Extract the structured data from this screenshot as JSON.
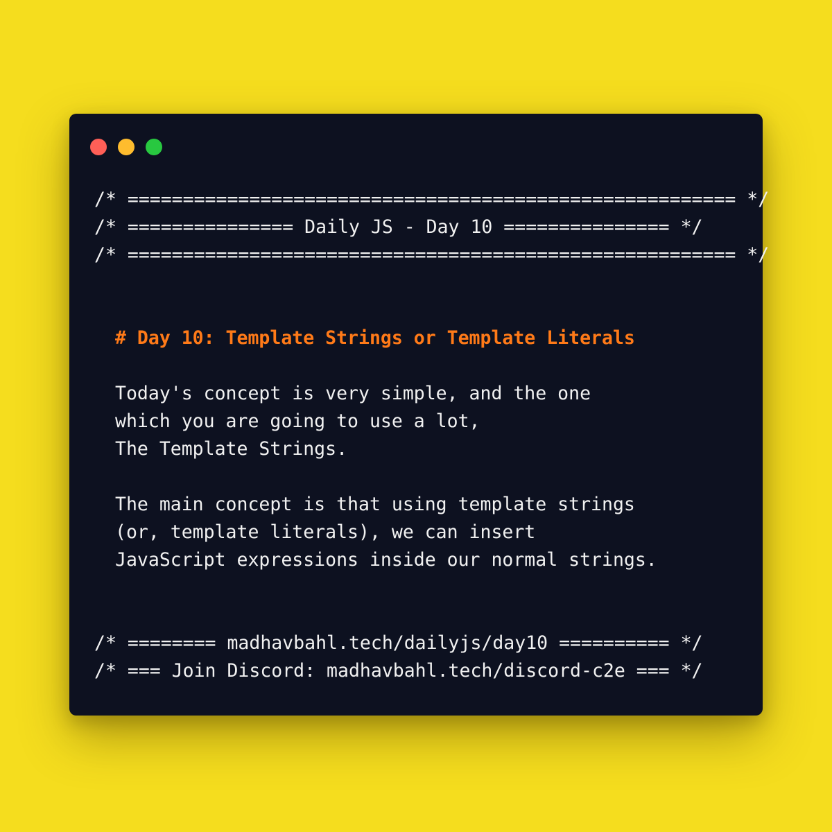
{
  "window": {
    "controls": [
      {
        "name": "close",
        "color": "#ff5f57"
      },
      {
        "name": "minimize",
        "color": "#febc2e"
      },
      {
        "name": "maximize",
        "color": "#28c840"
      }
    ]
  },
  "colors": {
    "page_background": "#f5dd1e",
    "window_background": "#0d1120",
    "text": "#f1f1f1",
    "heading": "#ff7a18"
  },
  "header": {
    "line1": "/* ======================================================= */",
    "line2": "/* =============== Daily JS - Day 10 =============== */",
    "line3": "/* ======================================================= */"
  },
  "content": {
    "heading": "# Day 10: Template Strings or Template Literals",
    "para1": [
      "Today's concept is very simple, and the one",
      "which you are going to use a lot,",
      "The Template Strings."
    ],
    "para2": [
      "The main concept is that using template strings",
      "(or, template literals), we can insert",
      "JavaScript expressions inside our normal strings."
    ]
  },
  "footer": {
    "line1": "/* ======== madhavbahl.tech/dailyjs/day10 ========== */",
    "line2": "/* === Join Discord: madhavbahl.tech/discord-c2e === */"
  }
}
